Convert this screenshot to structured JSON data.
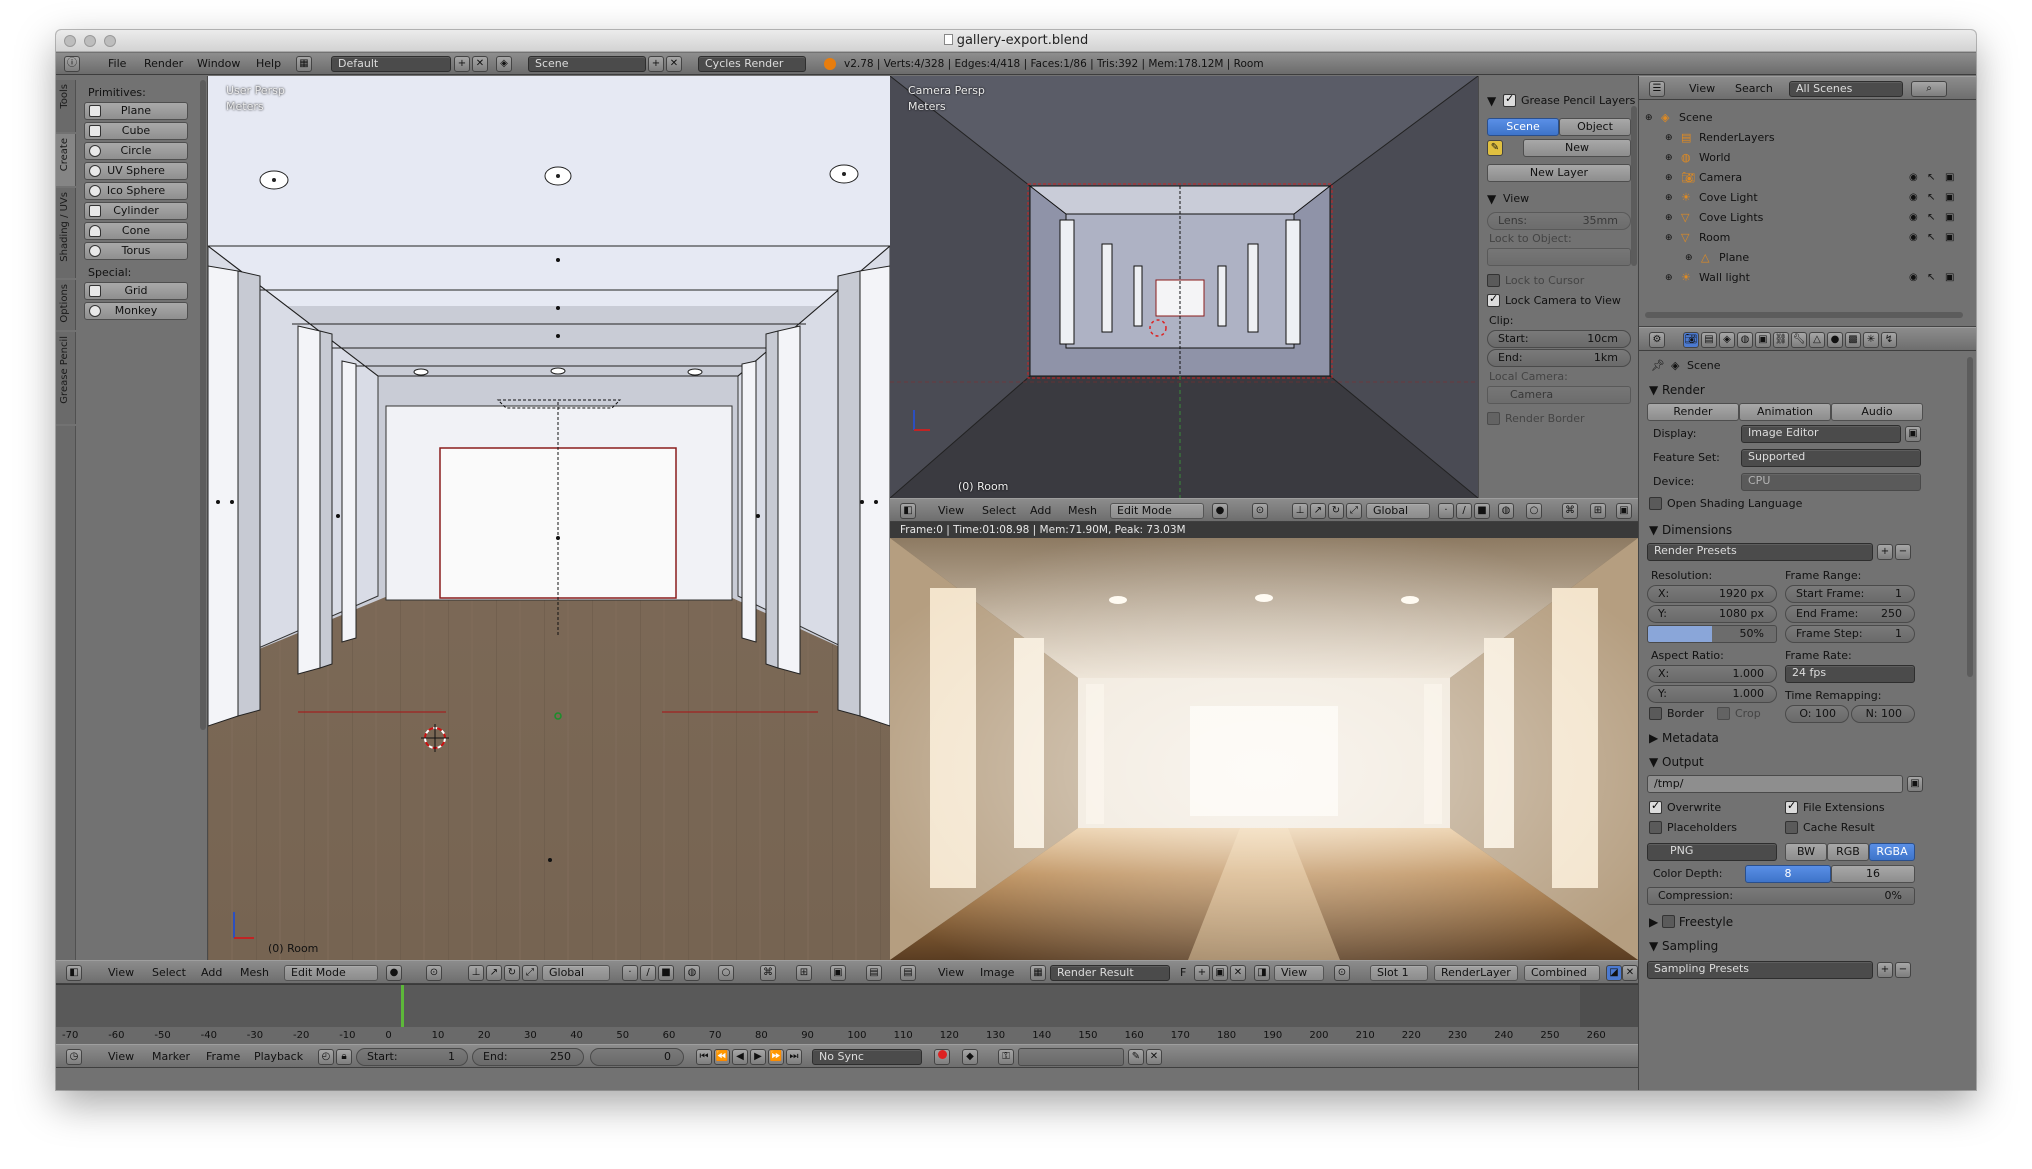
{
  "window": {
    "title": "gallery-export.blend"
  },
  "infobar": {
    "menus": [
      "File",
      "Render",
      "Window",
      "Help"
    ],
    "layout": "Default",
    "scene": "Scene",
    "engine": "Cycles Render",
    "stats": "v2.78 | Verts:4/328 | Edges:4/418 | Faces:1/86 | Tris:392 | Mem:178.12M | Room"
  },
  "tools": {
    "tabs": [
      "Tools",
      "Create",
      "Shading / UVs",
      "Options",
      "Grease Pencil"
    ],
    "primitives_label": "Primitives:",
    "primitives": [
      "Plane",
      "Cube",
      "Circle",
      "UV Sphere",
      "Ico Sphere",
      "Cylinder",
      "Cone",
      "Torus"
    ],
    "special_label": "Special:",
    "special": [
      "Grid",
      "Monkey"
    ]
  },
  "viewport_user": {
    "title": "User Persp",
    "units": "Meters",
    "object": "(0) Room"
  },
  "viewport_camera": {
    "title": "Camera Persp",
    "units": "Meters",
    "object": "(0) Room"
  },
  "view3d_header": {
    "view": "View",
    "select": "Select",
    "add": "Add",
    "mesh": "Mesh",
    "mode": "Edit Mode",
    "orientation": "Global"
  },
  "camera_sidebar": {
    "gp_title": "Grease Pencil Layers",
    "scene_btn": "Scene",
    "object_btn": "Object",
    "new_btn": "New",
    "new_layer_btn": "New Layer",
    "view_title": "View",
    "lens_label": "Lens:",
    "lens_value": "35mm",
    "lock_object_label": "Lock to Object:",
    "lock_cursor": "Lock to Cursor",
    "lock_camera": "Lock Camera to View",
    "clip_label": "Clip:",
    "clip_start_label": "Start:",
    "clip_start": "10cm",
    "clip_end_label": "End:",
    "clip_end": "1km",
    "local_camera_label": "Local Camera:",
    "local_camera_value": "Camera",
    "render_border": "Render Border"
  },
  "render_view": {
    "info": "Frame:0 | Time:01:08.98 | Mem:71.90M, Peak: 73.03M",
    "header": {
      "view": "View",
      "image": "Image",
      "result": "Render Result",
      "f": "F",
      "view2": "View",
      "slot": "Slot 1",
      "layer": "RenderLayer",
      "pass": "Combined"
    }
  },
  "outliner": {
    "view": "View",
    "search": "Search",
    "filter": "All Scenes",
    "items": [
      {
        "label": "Scene",
        "depth": 0
      },
      {
        "label": "RenderLayers",
        "depth": 1
      },
      {
        "label": "World",
        "depth": 1
      },
      {
        "label": "Camera",
        "depth": 1
      },
      {
        "label": "Cove Light",
        "depth": 1
      },
      {
        "label": "Cove Lights",
        "depth": 1
      },
      {
        "label": "Room",
        "depth": 1
      },
      {
        "label": "Plane",
        "depth": 2
      },
      {
        "label": "Wall light",
        "depth": 1
      }
    ]
  },
  "properties": {
    "context": "Scene",
    "render_section": "Render",
    "tabs": [
      "Render",
      "Animation",
      "Audio"
    ],
    "display_label": "Display:",
    "display": "Image Editor",
    "feature_label": "Feature Set:",
    "feature": "Supported",
    "device_label": "Device:",
    "device": "CPU",
    "osl": "Open Shading Language",
    "dimensions_section": "Dimensions",
    "presets": "Render Presets",
    "resolution_label": "Resolution:",
    "res_x_label": "X:",
    "res_x": "1920 px",
    "res_y_label": "Y:",
    "res_y": "1080 px",
    "res_pct": "50%",
    "frame_range_label": "Frame Range:",
    "start_frame_label": "Start Frame:",
    "start_frame": "1",
    "end_frame_label": "End Frame:",
    "end_frame": "250",
    "frame_step_label": "Frame Step:",
    "frame_step": "1",
    "aspect_label": "Aspect Ratio:",
    "asp_x_label": "X:",
    "asp_x": "1.000",
    "asp_y_label": "Y:",
    "asp_y": "1.000",
    "frame_rate_label": "Frame Rate:",
    "frame_rate": "24 fps",
    "time_remap_label": "Time Remapping:",
    "remap_old": "O: 100",
    "remap_new": "N: 100",
    "border": "Border",
    "crop": "Crop",
    "metadata_section": "Metadata",
    "output_section": "Output",
    "output_path": "/tmp/",
    "overwrite": "Overwrite",
    "file_ext": "File Extensions",
    "placeholders": "Placeholders",
    "cache_result": "Cache Result",
    "format": "PNG",
    "bw": "BW",
    "rgb": "RGB",
    "rgba": "RGBA",
    "color_depth_label": "Color Depth:",
    "depth_8": "8",
    "depth_16": "16",
    "compression_label": "Compression:",
    "compression": "0%",
    "freestyle_section": "Freestyle",
    "sampling_section": "Sampling",
    "sampling_presets": "Sampling Presets"
  },
  "timeline": {
    "ticks": [
      "-70",
      "-60",
      "-50",
      "-40",
      "-30",
      "-20",
      "-10",
      "0",
      "10",
      "20",
      "30",
      "40",
      "50",
      "60",
      "70",
      "80",
      "90",
      "100",
      "110",
      "120",
      "130",
      "140",
      "150",
      "160",
      "170",
      "180",
      "190",
      "200",
      "210",
      "220",
      "230",
      "240",
      "250",
      "260"
    ],
    "view": "View",
    "marker": "Marker",
    "frame": "Frame",
    "playback": "Playback",
    "start_label": "Start:",
    "start": "1",
    "end_label": "End:",
    "end": "250",
    "current": "0",
    "sync": "No Sync"
  }
}
